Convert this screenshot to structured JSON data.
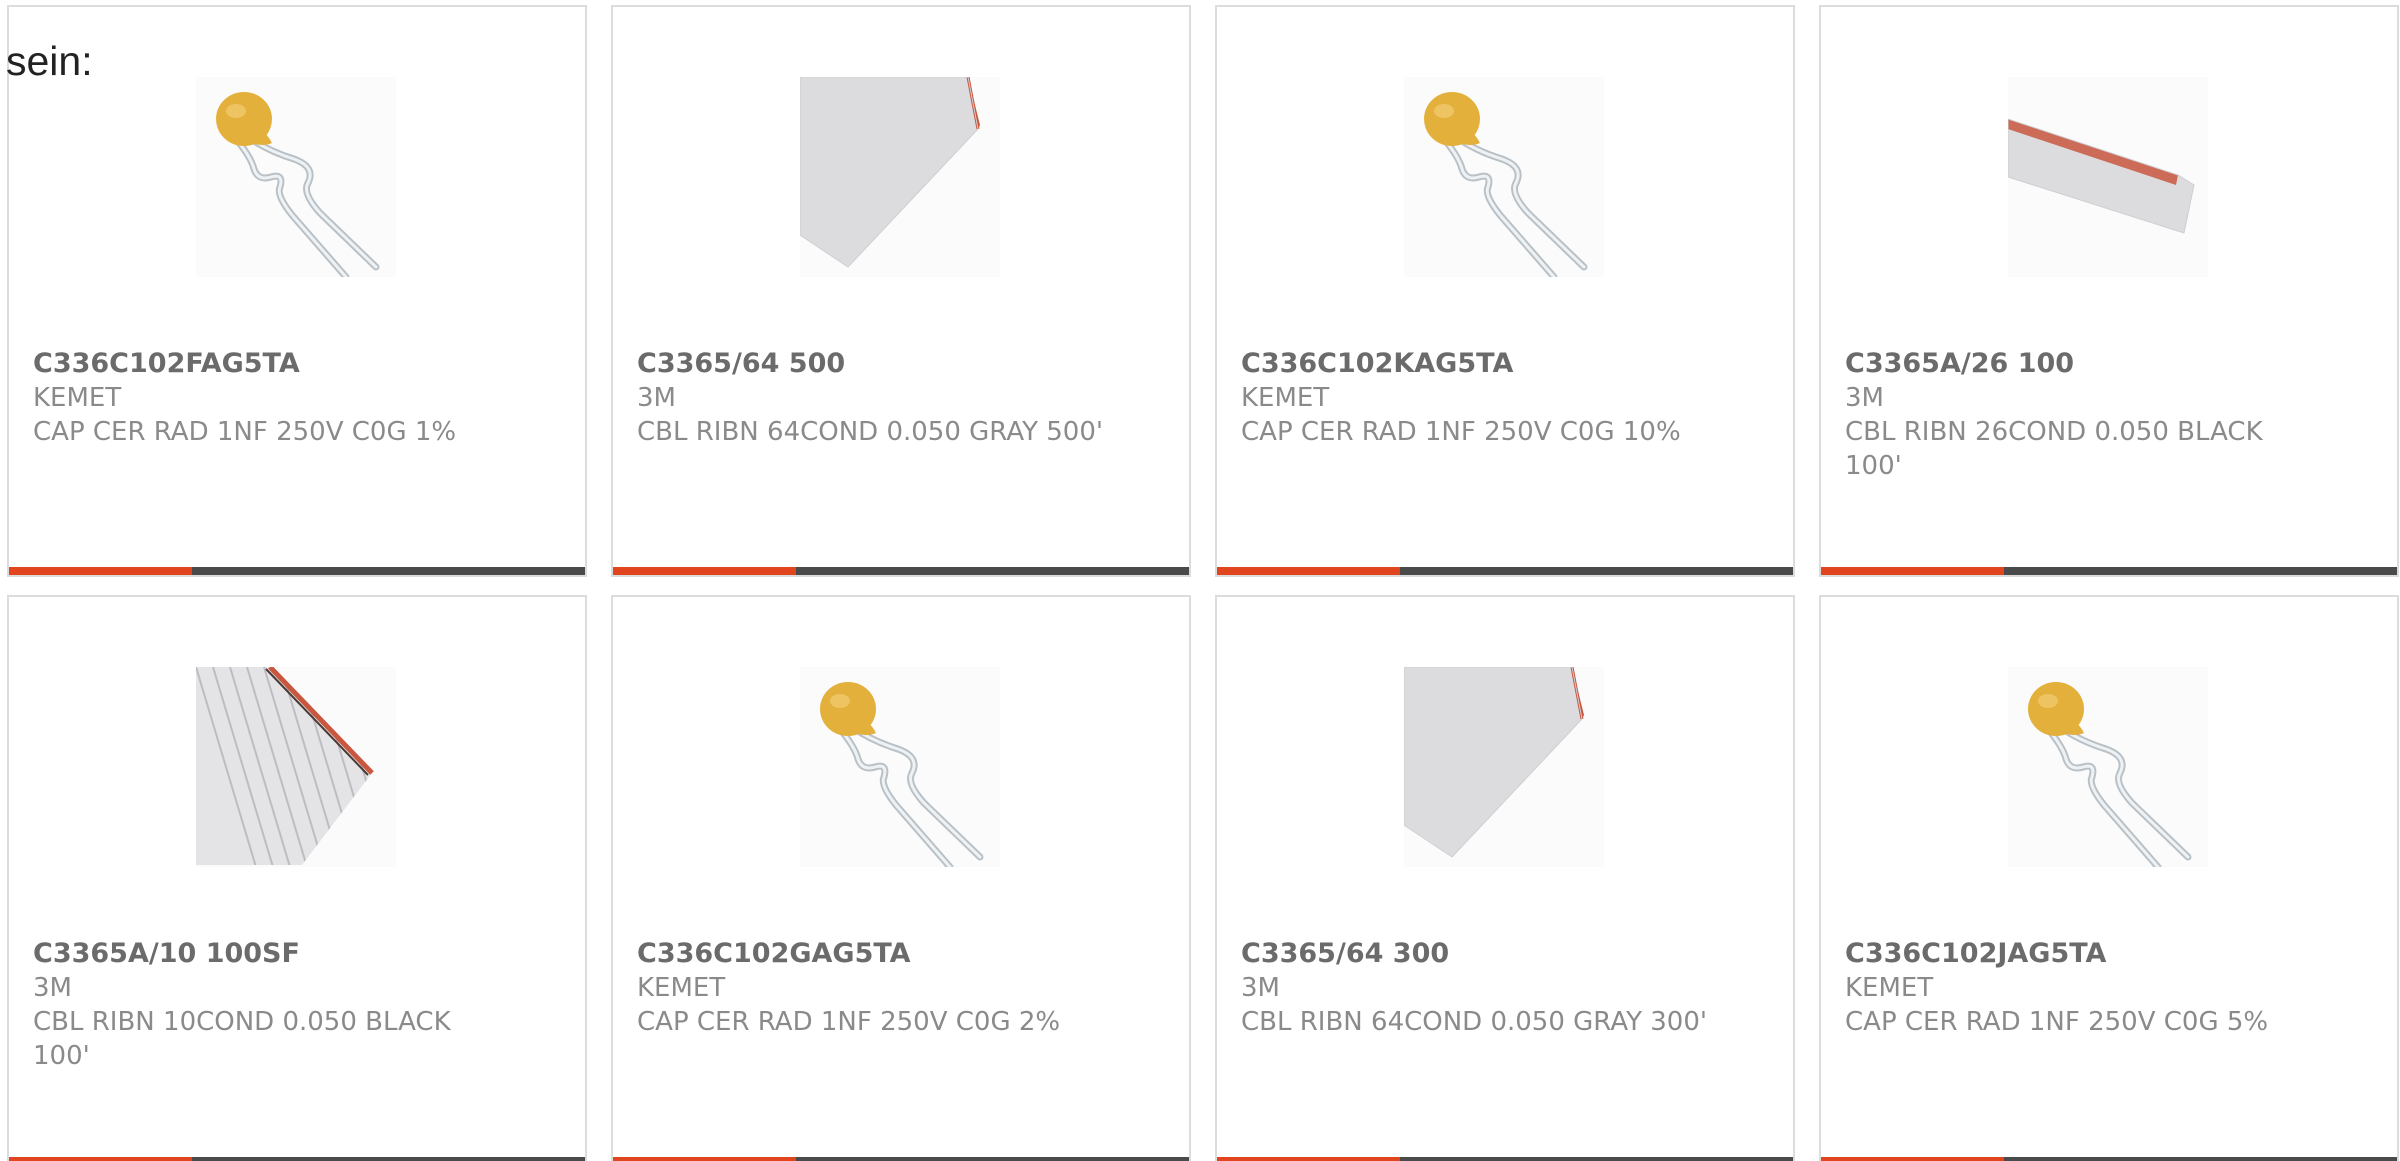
{
  "lead_text": "sein:",
  "colors": {
    "accent": "#e0451e",
    "bar": "#4a4a4a",
    "border": "#dcdcdc",
    "capacitor_body": "#e3b03c",
    "ribbon_gray": "#dcdcde",
    "ribbon_edge": "#c9573f"
  },
  "products": [
    {
      "part_number": "C336C102FAG5TA",
      "manufacturer": "KEMET",
      "description": "CAP CER RAD 1NF 250V C0G 1%",
      "image": "ceramic-capacitor-icon"
    },
    {
      "part_number": "C3365/64 500",
      "manufacturer": "3M",
      "description": "CBL RIBN 64COND 0.050 GRAY 500'",
      "image": "ribbon-cable-wide-icon"
    },
    {
      "part_number": "C336C102KAG5TA",
      "manufacturer": "KEMET",
      "description": "CAP CER RAD 1NF 250V C0G 10%",
      "image": "ceramic-capacitor-icon"
    },
    {
      "part_number": "C3365A/26 100",
      "manufacturer": "3M",
      "description": "CBL RIBN 26COND 0.050 BLACK 100'",
      "image": "ribbon-cable-narrow-icon"
    },
    {
      "part_number": "C3365A/10 100SF",
      "manufacturer": "3M",
      "description": "CBL RIBN 10COND 0.050 BLACK 100'",
      "image": "ribbon-cable-striped-icon"
    },
    {
      "part_number": "C336C102GAG5TA",
      "manufacturer": "KEMET",
      "description": "CAP CER RAD 1NF 250V C0G 2%",
      "image": "ceramic-capacitor-icon"
    },
    {
      "part_number": "C3365/64 300",
      "manufacturer": "3M",
      "description": "CBL RIBN 64COND 0.050 GRAY 300'",
      "image": "ribbon-cable-wide-icon"
    },
    {
      "part_number": "C336C102JAG5TA",
      "manufacturer": "KEMET",
      "description": "CAP CER RAD 1NF 250V C0G 5%",
      "image": "ceramic-capacitor-icon"
    }
  ]
}
